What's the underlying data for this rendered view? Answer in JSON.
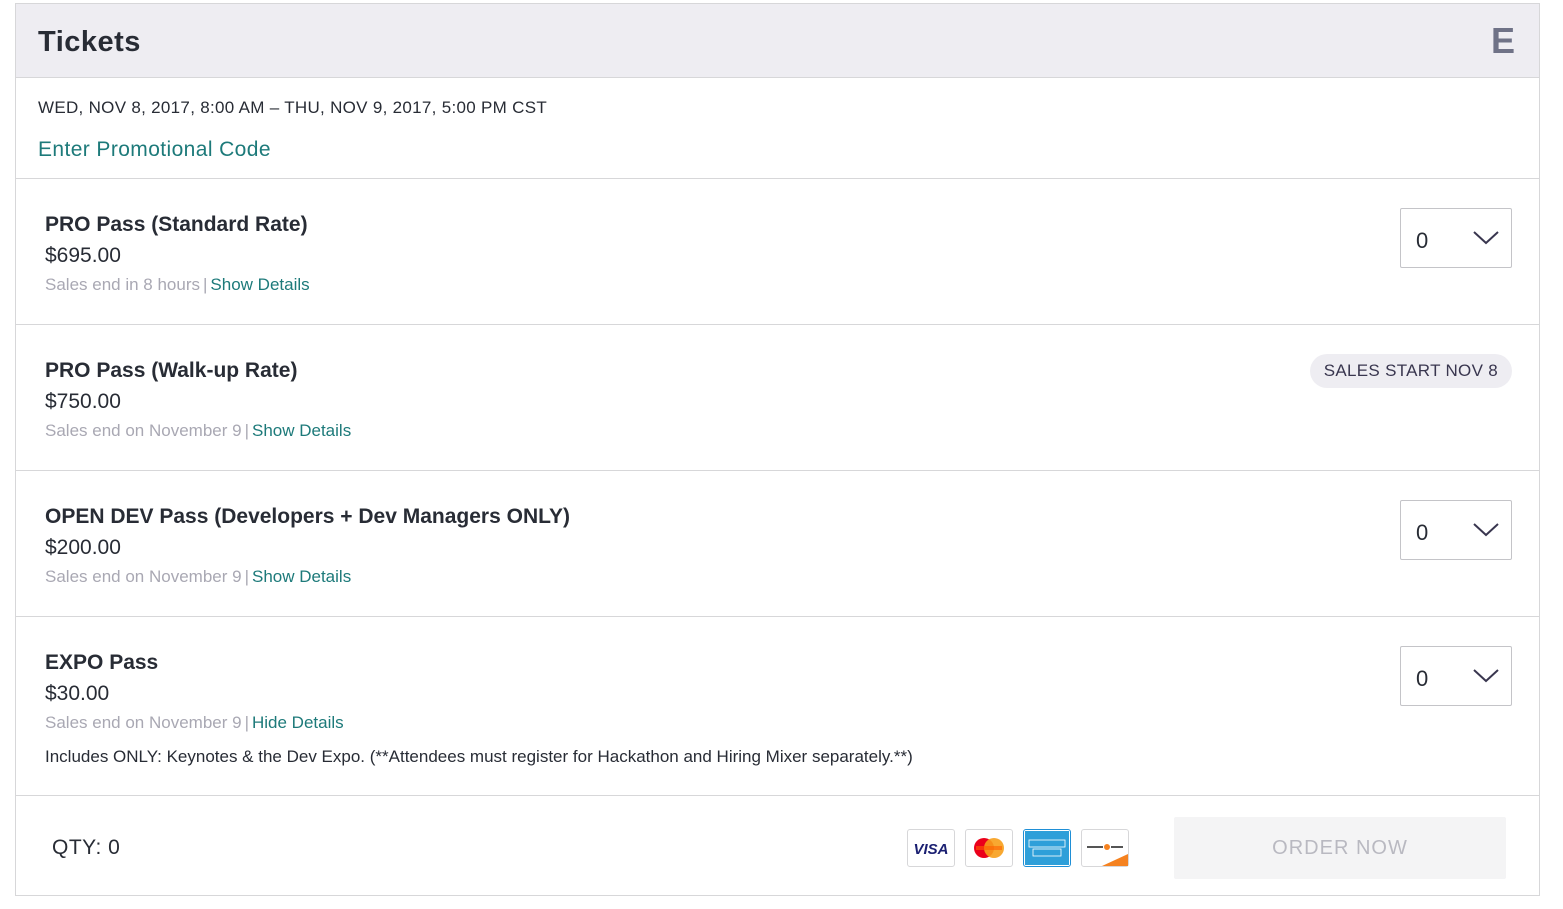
{
  "header": {
    "title": "Tickets",
    "brand_letter": "E"
  },
  "event": {
    "date_range": "WED, NOV 8, 2017, 8:00 AM – THU, NOV 9, 2017, 5:00 PM CST",
    "promo_link": "Enter Promotional Code"
  },
  "tickets": [
    {
      "name": "PRO Pass (Standard Rate)",
      "price": "$695.00",
      "sales_note": "Sales end in 8 hours",
      "details_link": "Show Details",
      "quantity": "0"
    },
    {
      "name": "PRO Pass (Walk-up Rate)",
      "price": "$750.00",
      "sales_note": "Sales end on November 9",
      "details_link": "Show Details",
      "badge": "SALES START NOV 8"
    },
    {
      "name": "OPEN DEV Pass (Developers + Dev Managers ONLY)",
      "price": "$200.00",
      "sales_note": "Sales end on November 9",
      "details_link": "Show Details",
      "quantity": "0"
    },
    {
      "name": "EXPO Pass",
      "price": "$30.00",
      "sales_note": "Sales end on November 9",
      "details_link": "Hide Details",
      "quantity": "0",
      "description": "Includes ONLY: Keynotes & the Dev Expo. (**Attendees must register for Hackathon and Hiring Mixer separately.**)"
    }
  ],
  "footer": {
    "qty_label": "QTY: 0",
    "payment_icons": [
      "visa-icon",
      "mastercard-icon",
      "american-express-icon",
      "discover-icon"
    ],
    "order_button": "ORDER NOW"
  },
  "colors": {
    "link": "#1d7a7a",
    "header_bg": "#eeedf2",
    "muted_text": "#a9a8b3",
    "disabled_button_bg": "#f4f4f5"
  }
}
